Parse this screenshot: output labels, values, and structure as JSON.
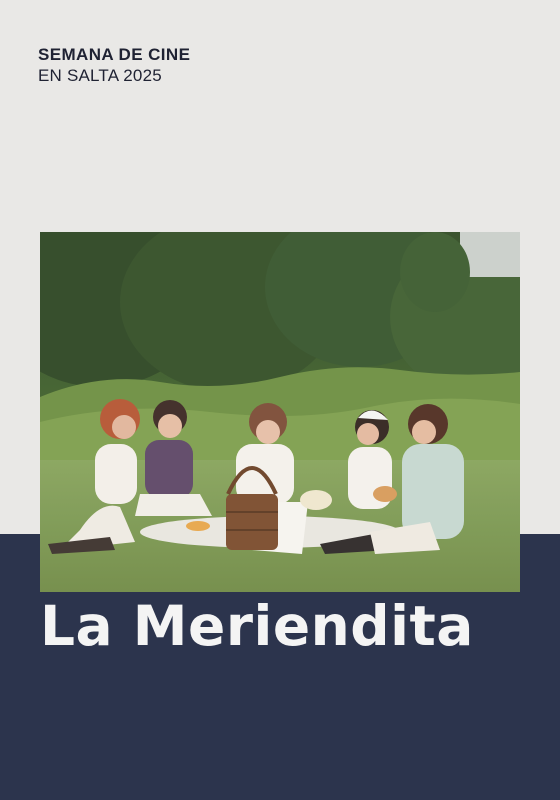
{
  "event": {
    "line1": "SEMANA DE CINE",
    "line2": "EN SALTA 2025"
  },
  "film": {
    "title": "La Meriendita"
  },
  "colors": {
    "background": "#e9e8e6",
    "band": "#2c344d",
    "title_text": "#f4f4f4",
    "heading_text": "#1f2233"
  }
}
